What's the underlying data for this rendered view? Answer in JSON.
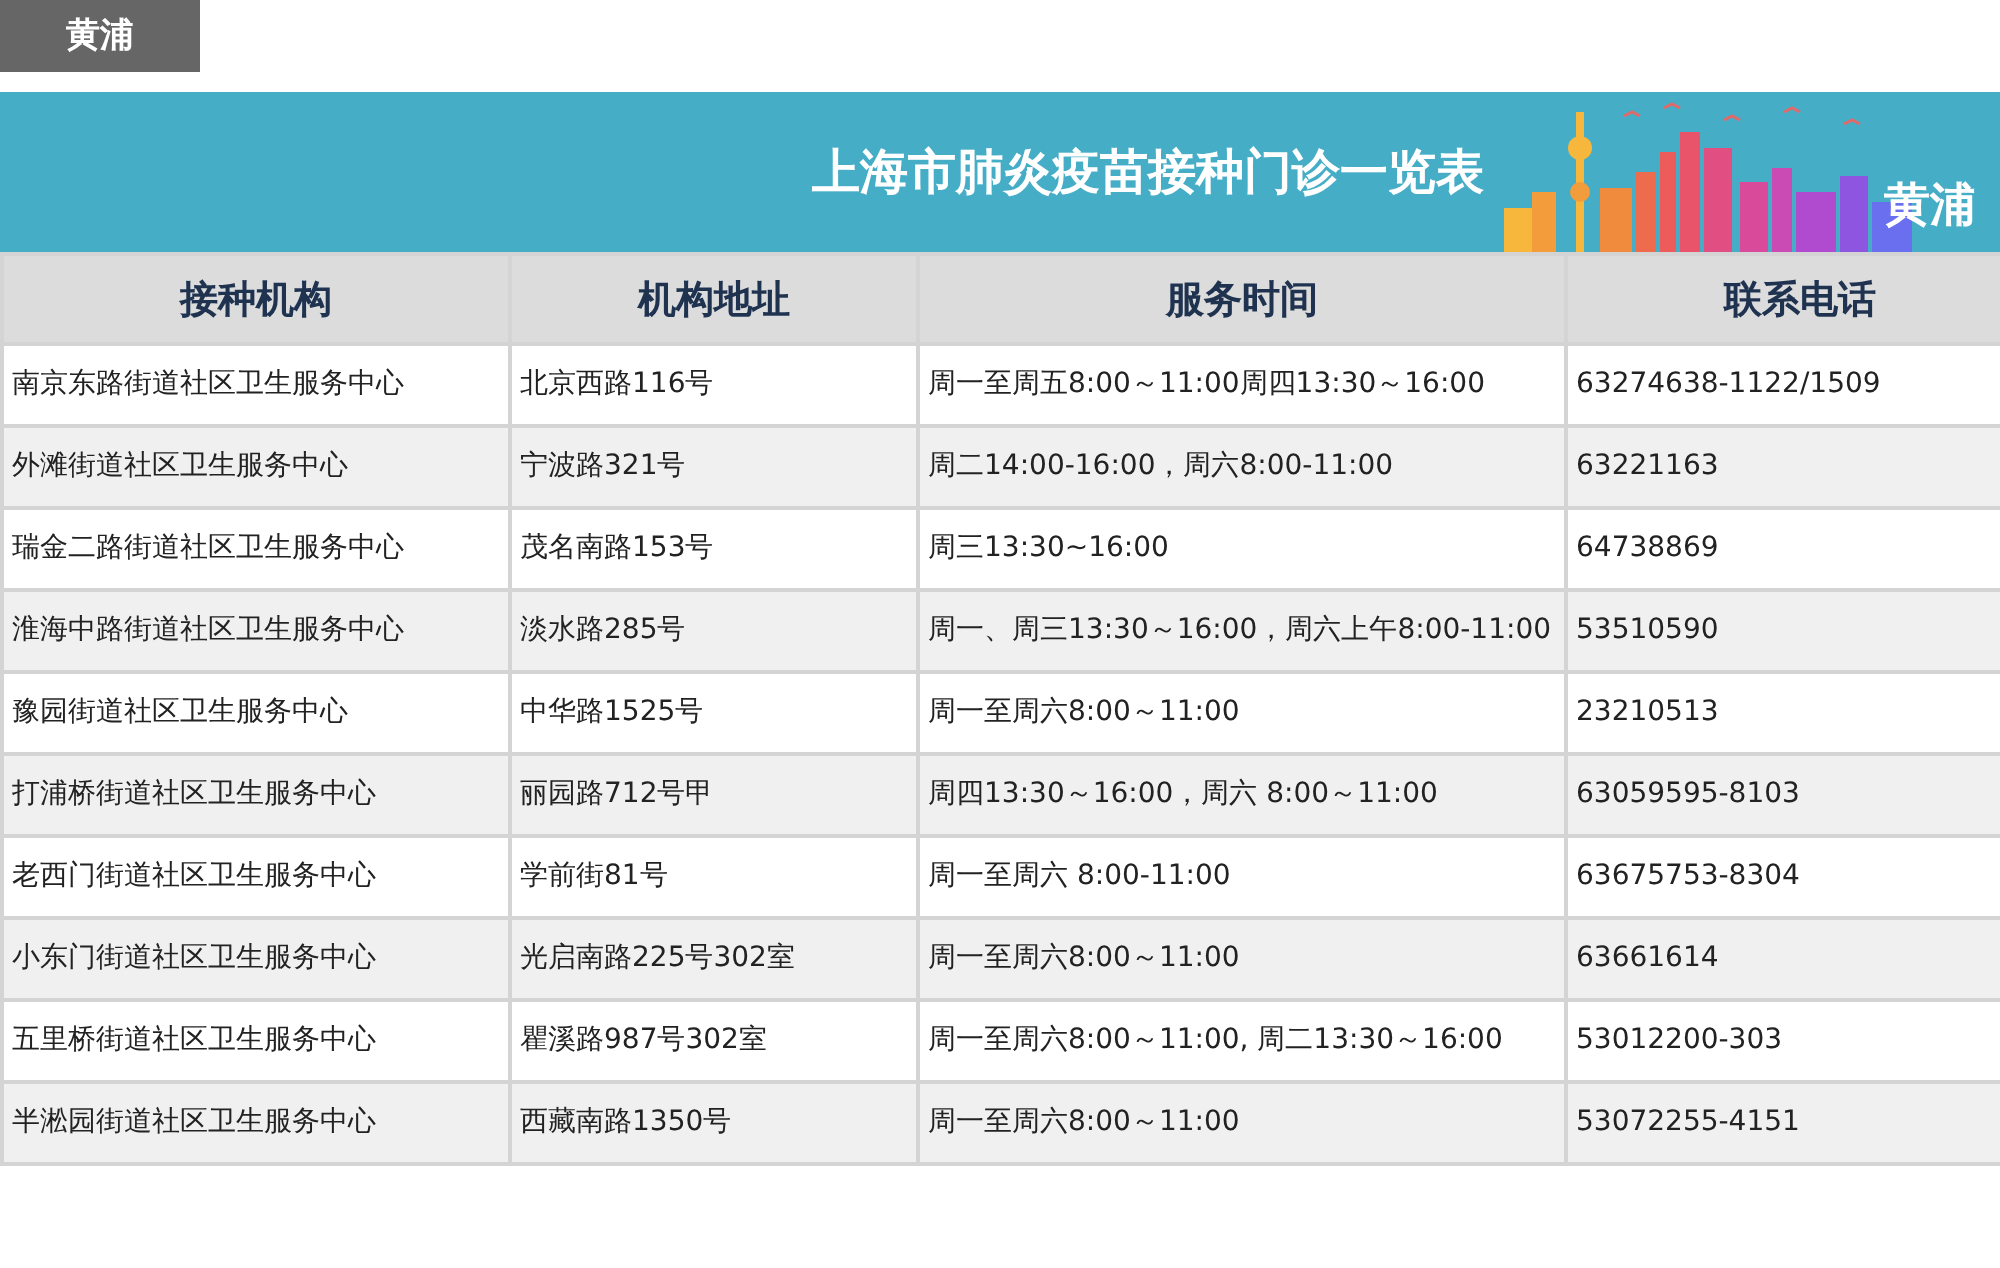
{
  "district_tag": "黄浦",
  "banner": {
    "title": "上海市肺炎疫苗接种门诊一览表",
    "district": "黄浦"
  },
  "table": {
    "columns": [
      "接种机构",
      "机构地址",
      "服务时间",
      "联系电话"
    ],
    "rows": [
      [
        "南京东路街道社区卫生服务中心",
        "北京西路116号",
        "周一至周五8:00～11:00周四13:30～16:00",
        "63274638-1122/1509"
      ],
      [
        "外滩街道社区卫生服务中心",
        "宁波路321号",
        "周二14:00-16:00，周六8:00-11:00",
        "63221163"
      ],
      [
        "瑞金二路街道社区卫生服务中心",
        "茂名南路153号",
        "周三13:30~16:00",
        "64738869"
      ],
      [
        "淮海中路街道社区卫生服务中心",
        "淡水路285号",
        "周一、周三13:30～16:00，周六上午8:00-11:00",
        "53510590"
      ],
      [
        "豫园街道社区卫生服务中心",
        "中华路1525号",
        "周一至周六8:00～11:00",
        "23210513"
      ],
      [
        "打浦桥街道社区卫生服务中心",
        "丽园路712号甲",
        "周四13:30～16:00，周六 8:00～11:00",
        "63059595-8103"
      ],
      [
        "老西门街道社区卫生服务中心",
        "学前街81号",
        "周一至周六 8:00-11:00",
        "63675753-8304"
      ],
      [
        "小东门街道社区卫生服务中心",
        "光启南路225号302室",
        "周一至周六8:00～11:00",
        "63661614"
      ],
      [
        "五里桥街道社区卫生服务中心",
        "瞿溪路987号302室",
        "周一至周六8:00～11:00, 周二13:30～16:00",
        "53012200-303"
      ],
      [
        "半淞园街道社区卫生服务中心",
        "西藏南路1350号",
        "周一至周六8:00～11:00",
        "53072255-4151"
      ]
    ]
  }
}
